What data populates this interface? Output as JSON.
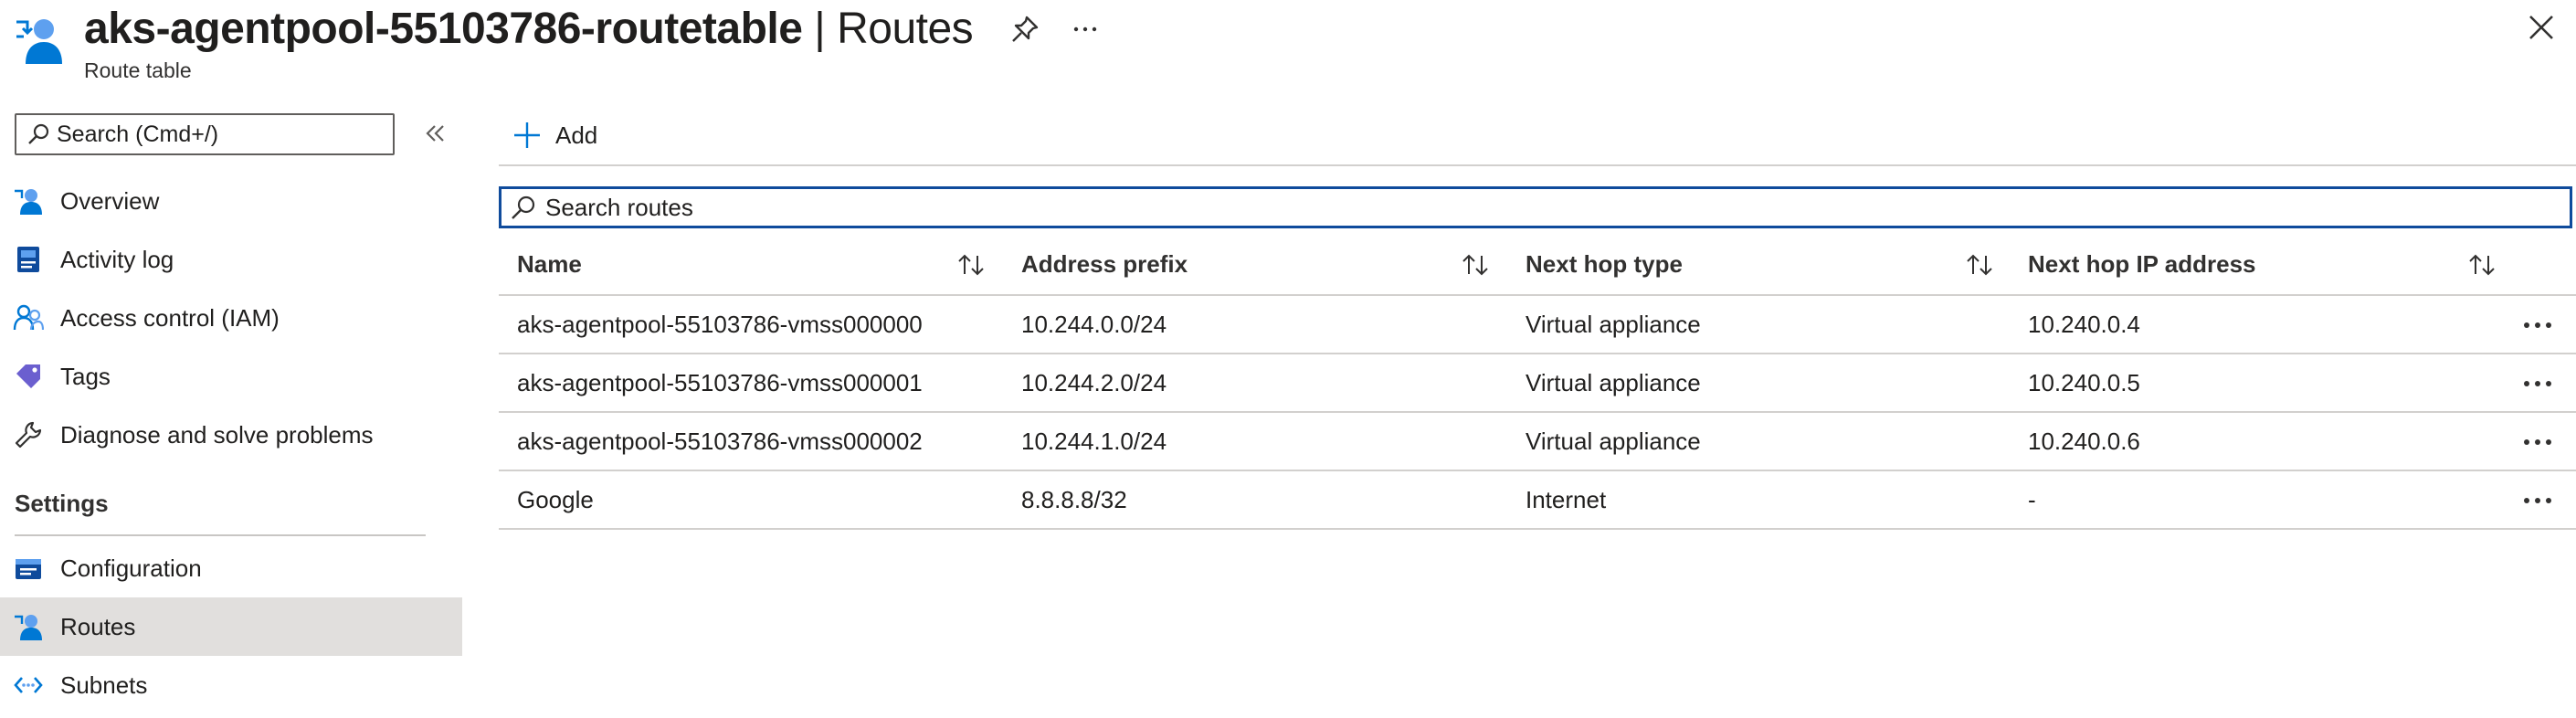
{
  "header": {
    "resource_name": "aks-agentpool-55103786-routetable",
    "separator": " | ",
    "blade_name": "Routes",
    "subtitle": "Route table",
    "icon": "route-table-icon"
  },
  "sidebar": {
    "search_placeholder": "Search (Cmd+/)",
    "items": [
      {
        "label": "Overview",
        "icon": "overview-icon"
      },
      {
        "label": "Activity log",
        "icon": "activity-log-icon"
      },
      {
        "label": "Access control (IAM)",
        "icon": "iam-icon"
      },
      {
        "label": "Tags",
        "icon": "tag-icon"
      },
      {
        "label": "Diagnose and solve problems",
        "icon": "wrench-icon"
      }
    ],
    "settings_heading": "Settings",
    "settings_items": [
      {
        "label": "Configuration",
        "icon": "configuration-icon"
      },
      {
        "label": "Routes",
        "icon": "routes-icon",
        "selected": true
      },
      {
        "label": "Subnets",
        "icon": "subnets-icon"
      }
    ]
  },
  "toolbar": {
    "add_label": "Add"
  },
  "routes": {
    "search_placeholder": "Search routes",
    "columns": [
      "Name",
      "Address prefix",
      "Next hop type",
      "Next hop IP address"
    ],
    "rows": [
      [
        "aks-agentpool-55103786-vmss000000",
        "10.244.0.0/24",
        "Virtual appliance",
        "10.240.0.4"
      ],
      [
        "aks-agentpool-55103786-vmss000001",
        "10.244.2.0/24",
        "Virtual appliance",
        "10.240.0.5"
      ],
      [
        "aks-agentpool-55103786-vmss000002",
        "10.244.1.0/24",
        "Virtual appliance",
        "10.240.0.6"
      ],
      [
        "Google",
        "8.8.8.8/32",
        "Internet",
        "-"
      ]
    ]
  },
  "colors": {
    "accent": "#0078d4",
    "focus_border": "#0f4b9c",
    "selected_bg": "#e1dfdd"
  }
}
